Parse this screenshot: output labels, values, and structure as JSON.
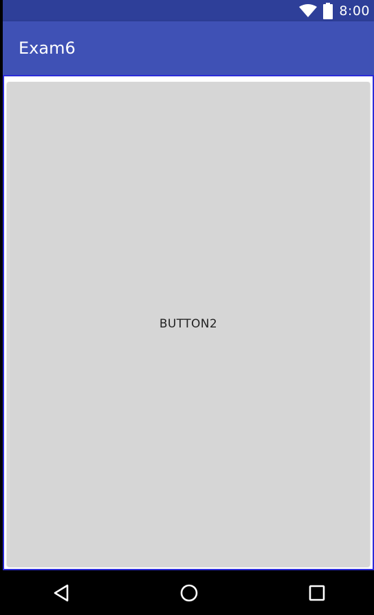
{
  "status_bar": {
    "time": "8:00",
    "icons": [
      "wifi-icon",
      "battery-icon"
    ],
    "color": "#2e3f99"
  },
  "app_bar": {
    "title": "Exam6",
    "color": "#3f51b5"
  },
  "main": {
    "button_label": "BUTTON2",
    "button_color": "#d6d6d6"
  },
  "nav_bar": {
    "icons": [
      "back-icon",
      "home-icon",
      "recent-apps-icon"
    ]
  }
}
